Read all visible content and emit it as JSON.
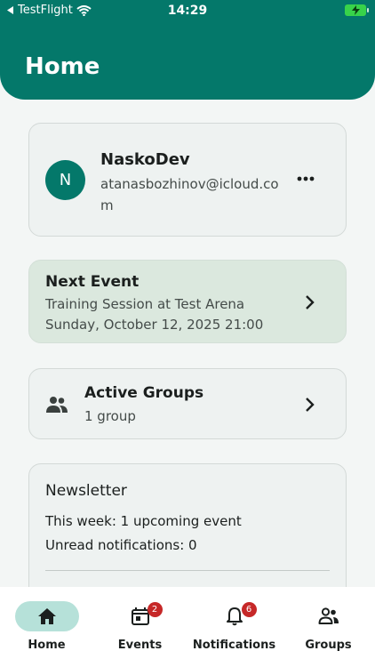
{
  "status_bar": {
    "back_app": "TestFlight",
    "time": "14:29"
  },
  "header": {
    "title": "Home"
  },
  "profile": {
    "avatar_initial": "N",
    "username": "NaskoDev",
    "email": "atanasbozhinov@icloud.com",
    "more_icon": "more-horizontal-icon"
  },
  "next_event": {
    "title": "Next Event",
    "name": "Training Session at Test Arena",
    "datetime": "Sunday, October 12, 2025 21:00"
  },
  "active_groups": {
    "title": "Active Groups",
    "count": "1 group",
    "icon": "people-icon"
  },
  "newsletter": {
    "title": "Newsletter",
    "line1": "This week: 1 upcoming event",
    "line2": "Unread notifications: 0"
  },
  "tabs": [
    {
      "label": "Home",
      "icon": "home-icon",
      "active": true
    },
    {
      "label": "Events",
      "icon": "calendar-icon",
      "badge": "2"
    },
    {
      "label": "Notifications",
      "icon": "bell-icon",
      "badge": "6"
    },
    {
      "label": "Groups",
      "icon": "people-icon"
    }
  ],
  "colors": {
    "primary": "#04786A",
    "active_tab_bg": "#B6E1D9",
    "next_event_bg": "#DBE8DE",
    "badge": "#C62828"
  }
}
